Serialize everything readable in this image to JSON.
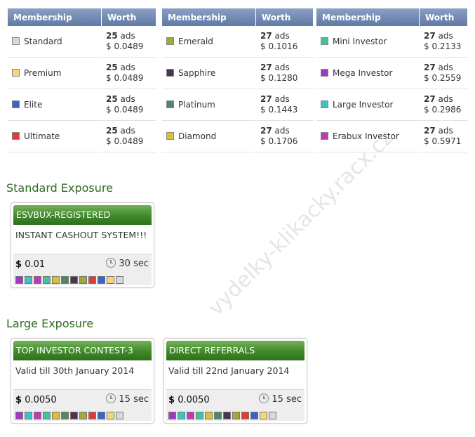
{
  "columns": {
    "membership": "Membership",
    "worth": "Worth"
  },
  "groups": [
    [
      {
        "name": "Standard",
        "ads": "25",
        "ads_unit": "ads",
        "worth": "$ 0.0489",
        "color": "#d9d9d9"
      },
      {
        "name": "Premium",
        "ads": "25",
        "ads_unit": "ads",
        "worth": "$ 0.0489",
        "color": "#f4d77c"
      },
      {
        "name": "Elite",
        "ads": "25",
        "ads_unit": "ads",
        "worth": "$ 0.0489",
        "color": "#3a63c9"
      },
      {
        "name": "Ultimate",
        "ads": "25",
        "ads_unit": "ads",
        "worth": "$ 0.0489",
        "color": "#e03a3a"
      }
    ],
    [
      {
        "name": "Emerald",
        "ads": "27",
        "ads_unit": "ads",
        "worth": "$ 0.1016",
        "color": "#a2a83a"
      },
      {
        "name": "Sapphire",
        "ads": "27",
        "ads_unit": "ads",
        "worth": "$ 0.1280",
        "color": "#4a3450"
      },
      {
        "name": "Platinum",
        "ads": "27",
        "ads_unit": "ads",
        "worth": "$ 0.1443",
        "color": "#4f8866"
      },
      {
        "name": "Diamond",
        "ads": "27",
        "ads_unit": "ads",
        "worth": "$ 0.1706",
        "color": "#d8c03a"
      }
    ],
    [
      {
        "name": "Mini Investor",
        "ads": "27",
        "ads_unit": "ads",
        "worth": "$ 0.2133",
        "color": "#3fc49e"
      },
      {
        "name": "Mega Investor",
        "ads": "27",
        "ads_unit": "ads",
        "worth": "$ 0.2559",
        "color": "#a03ac0"
      },
      {
        "name": "Large Investor",
        "ads": "27",
        "ads_unit": "ads",
        "worth": "$ 0.2986",
        "color": "#3ac4c4"
      },
      {
        "name": "Erabux Investor",
        "ads": "27",
        "ads_unit": "ads",
        "worth": "$ 0.5971",
        "color": "#c03ab8"
      }
    ]
  ],
  "sections": {
    "standard": "Standard Exposure",
    "large": "Large Exposure"
  },
  "ads": [
    {
      "title": "ESVBUX-REGISTERED",
      "desc": "INSTANT CASHOUT SYSTEM!!!",
      "currency": "$",
      "price": "0.01",
      "time": "30 sec"
    },
    {
      "title": "TOP INVESTOR CONTEST-3",
      "desc": "Valid till 30th January 2014",
      "currency": "$",
      "price": "0.0050",
      "time": "15 sec"
    },
    {
      "title": "DIRECT REFERRALS",
      "desc": "Valid till 22nd January 2014",
      "currency": "$",
      "price": "0.0050",
      "time": "15 sec"
    }
  ],
  "membership_squares": [
    "#a03ac0",
    "#3ac4c4",
    "#c03ab8",
    "#3fc49e",
    "#d8c03a",
    "#4f8866",
    "#4a3450",
    "#a2a83a",
    "#e03a3a",
    "#3a63c9",
    "#f4d77c",
    "#d9d9d9"
  ],
  "watermark": "vydelky-klikacky.racx.cz",
  "icons": {
    "clock": "clock-icon",
    "swatch": "membership-color-icon"
  }
}
